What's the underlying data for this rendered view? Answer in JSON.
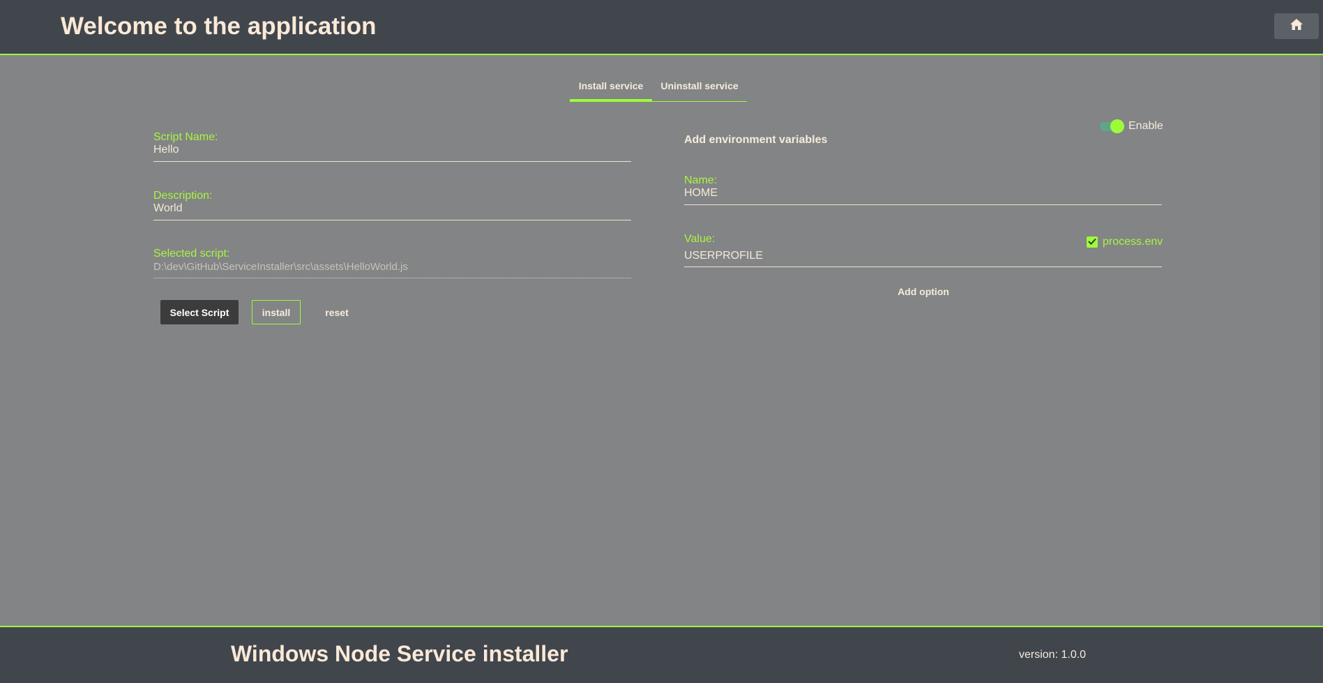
{
  "header": {
    "title": "Welcome to the application",
    "home_icon": "home-icon"
  },
  "tabs": [
    {
      "label": "Install service",
      "active": true
    },
    {
      "label": "Uninstall service",
      "active": false
    }
  ],
  "form": {
    "script_name": {
      "label": "Script Name:",
      "value": "Hello"
    },
    "description": {
      "label": "Description:",
      "value": "World"
    },
    "selected_script": {
      "label": "Selected script:",
      "value": "D:\\dev\\GitHub\\ServiceInstaller\\src\\assets\\HelloWorld.js"
    },
    "buttons": {
      "select": "Select Script",
      "install": "install",
      "reset": "reset"
    }
  },
  "env": {
    "heading": "Add environment variables",
    "toggle": {
      "label": "Enable",
      "checked": true
    },
    "name": {
      "label": "Name:",
      "value": "HOME"
    },
    "value": {
      "label": "Value:",
      "value": "USERPROFILE"
    },
    "process_env": {
      "label": "process.env",
      "checked": true
    },
    "add_option": "Add option"
  },
  "footer": {
    "title": "Windows Node Service installer",
    "version": "version: 1.0.0"
  },
  "colors": {
    "accent": "#9dfc3a",
    "header_bg": "#41464d",
    "page_bg": "#838485",
    "text_light": "#f6ecdc",
    "label_green": "#a7f542"
  }
}
